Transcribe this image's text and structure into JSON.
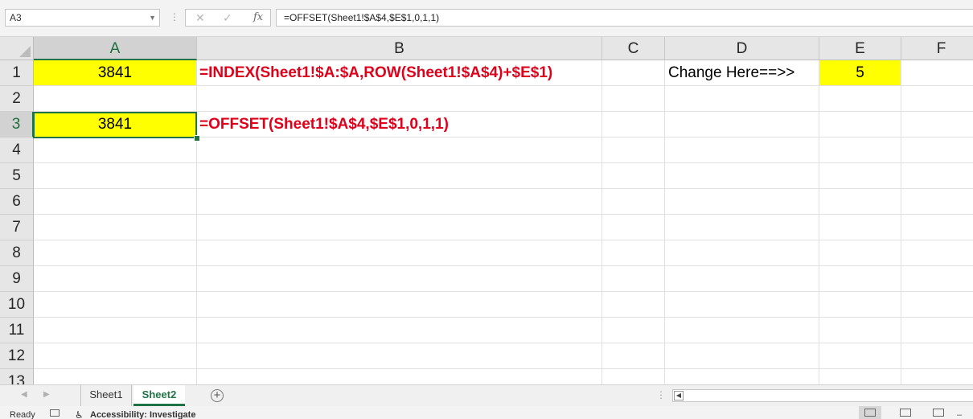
{
  "formula_bar": {
    "name_box": "A3",
    "dropdown_glyph": "▼",
    "dots": "⋮",
    "cancel_glyph": "✕",
    "enter_glyph": "✓",
    "fx_label": "fx",
    "formula": "=OFFSET(Sheet1!$A$4,$E$1,0,1,1)"
  },
  "grid": {
    "columns": [
      "A",
      "B",
      "C",
      "D",
      "E",
      "F"
    ],
    "selected_column": "A",
    "rows": [
      "1",
      "2",
      "3",
      "4",
      "5",
      "6",
      "7",
      "8",
      "9",
      "10",
      "11",
      "12",
      "13"
    ],
    "selected_row": "3",
    "cells": {
      "A1": "3841",
      "B1": "=INDEX(Sheet1!$A:$A,ROW(Sheet1!$A$4)+$E$1)",
      "D1": "Change Here==>>",
      "E1": "5",
      "A3": "3841",
      "B3": "=OFFSET(Sheet1!$A$4,$E$1,0,1,1)"
    },
    "highlight_color": "#ffff00",
    "formula_text_color": "#e0001a",
    "selection_color": "#217346"
  },
  "sheet_tabs": {
    "prev_glyph": "◀",
    "next_glyph": "▶",
    "tabs": [
      "Sheet1",
      "Sheet2"
    ],
    "active_tab": "Sheet2",
    "add_glyph": "+",
    "dots": "⋮",
    "scroll_left_glyph": "◀"
  },
  "status_bar": {
    "ready": "Ready",
    "accessibility_icon": "♿",
    "accessibility": "Accessibility: Investigate",
    "zoom_glyph": "–"
  }
}
